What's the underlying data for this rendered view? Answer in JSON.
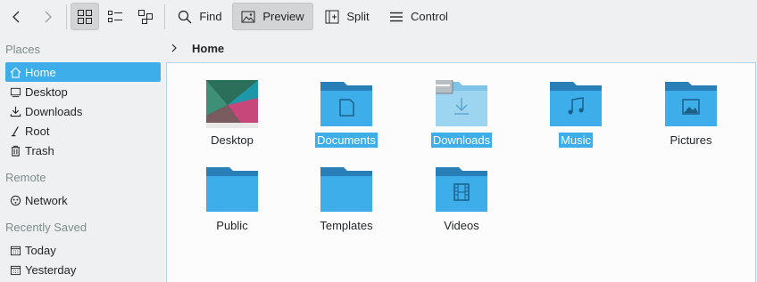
{
  "toolbar": {
    "back_icon": "chevron-left-icon",
    "forward_icon": "chevron-right-icon",
    "view_icons": [
      "icons-view-icon",
      "details-view-icon",
      "tree-view-icon"
    ],
    "find_label": "Find",
    "preview_label": "Preview",
    "split_label": "Split",
    "control_label": "Control"
  },
  "sidebar": {
    "sections": [
      {
        "title": "Places",
        "items": [
          {
            "label": "Home",
            "icon": "home-icon",
            "selected": true
          },
          {
            "label": "Desktop",
            "icon": "desktop-icon"
          },
          {
            "label": "Downloads",
            "icon": "download-icon"
          },
          {
            "label": "Root",
            "icon": "root-icon"
          },
          {
            "label": "Trash",
            "icon": "trash-icon"
          }
        ]
      },
      {
        "title": "Remote",
        "items": [
          {
            "label": "Network",
            "icon": "network-icon"
          }
        ]
      },
      {
        "title": "Recently Saved",
        "items": [
          {
            "label": "Today",
            "icon": "calendar-icon"
          },
          {
            "label": "Yesterday",
            "icon": "calendar-icon"
          }
        ]
      }
    ]
  },
  "breadcrumb": {
    "current": "Home"
  },
  "files": [
    {
      "name": "Desktop",
      "type": "desktop",
      "selected": false
    },
    {
      "name": "Documents",
      "type": "documents",
      "selected": true
    },
    {
      "name": "Downloads",
      "type": "downloads",
      "selected": true
    },
    {
      "name": "Music",
      "type": "music",
      "selected": true
    },
    {
      "name": "Pictures",
      "type": "pictures",
      "selected": false
    },
    {
      "name": "Public",
      "type": "folder",
      "selected": false
    },
    {
      "name": "Templates",
      "type": "folder",
      "selected": false
    },
    {
      "name": "Videos",
      "type": "videos",
      "selected": false
    }
  ],
  "colors": {
    "accent": "#3daee9",
    "folder_back": "#2980b9",
    "folder_front": "#3daee9"
  }
}
